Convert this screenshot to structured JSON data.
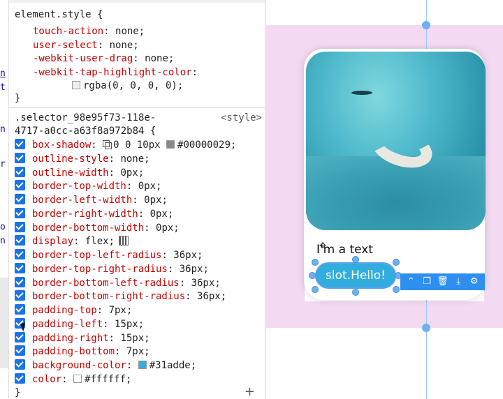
{
  "sidebar_fragments": [
    "n",
    "t",
    "n",
    "r",
    "o",
    "n"
  ],
  "element_style": {
    "selector": "element.style {",
    "rules": [
      {
        "prop": "touch-action",
        "value": "none;"
      },
      {
        "prop": "user-select",
        "value": "none;"
      },
      {
        "prop": "-webkit-user-drag",
        "value": "none;"
      },
      {
        "prop": "-webkit-tap-highlight-color",
        "value": ""
      }
    ],
    "tap_color_value": "rgba(0, 0, 0, 0);",
    "close": "}"
  },
  "rule2": {
    "selector_line1": ".selector_98e95f73-118e-",
    "selector_line2": "4717-a0cc-a63f8a972b84 {",
    "source": "<style>",
    "rules": [
      {
        "prop": "box-shadow",
        "value": "0 0 10px",
        "extra": "#00000029;"
      },
      {
        "prop": "outline-style",
        "value": "none;"
      },
      {
        "prop": "outline-width",
        "value": "0px;"
      },
      {
        "prop": "border-top-width",
        "value": "0px;"
      },
      {
        "prop": "border-left-width",
        "value": "0px;"
      },
      {
        "prop": "border-right-width",
        "value": "0px;"
      },
      {
        "prop": "border-bottom-width",
        "value": "0px;"
      },
      {
        "prop": "display",
        "value": "flex;"
      },
      {
        "prop": "border-top-left-radius",
        "value": "36px;"
      },
      {
        "prop": "border-top-right-radius",
        "value": "36px;"
      },
      {
        "prop": "border-bottom-left-radius",
        "value": "36px;"
      },
      {
        "prop": "border-bottom-right-radius",
        "value": "36px;"
      },
      {
        "prop": "padding-top",
        "value": "7px;"
      },
      {
        "prop": "padding-left",
        "value": "15px;"
      },
      {
        "prop": "padding-right",
        "value": "15px;"
      },
      {
        "prop": "padding-bottom",
        "value": "7px;"
      },
      {
        "prop": "background-color",
        "value": "#31adde;"
      },
      {
        "prop": "color",
        "value": "#ffffff;"
      }
    ],
    "close": "}"
  },
  "colors": {
    "button_bg": "#31adde",
    "button_text": "#ffffff",
    "shadow": "#00000029",
    "checkbox": "#1a73e8",
    "toolbar": "#2e8ff0"
  },
  "canvas": {
    "text_label": "I'm a text",
    "button_label": "slot.Hello!",
    "toolbar_icons": [
      "chevrons-up-icon",
      "copy-icon",
      "trash-icon",
      "download-icon",
      "gear-icon"
    ]
  }
}
